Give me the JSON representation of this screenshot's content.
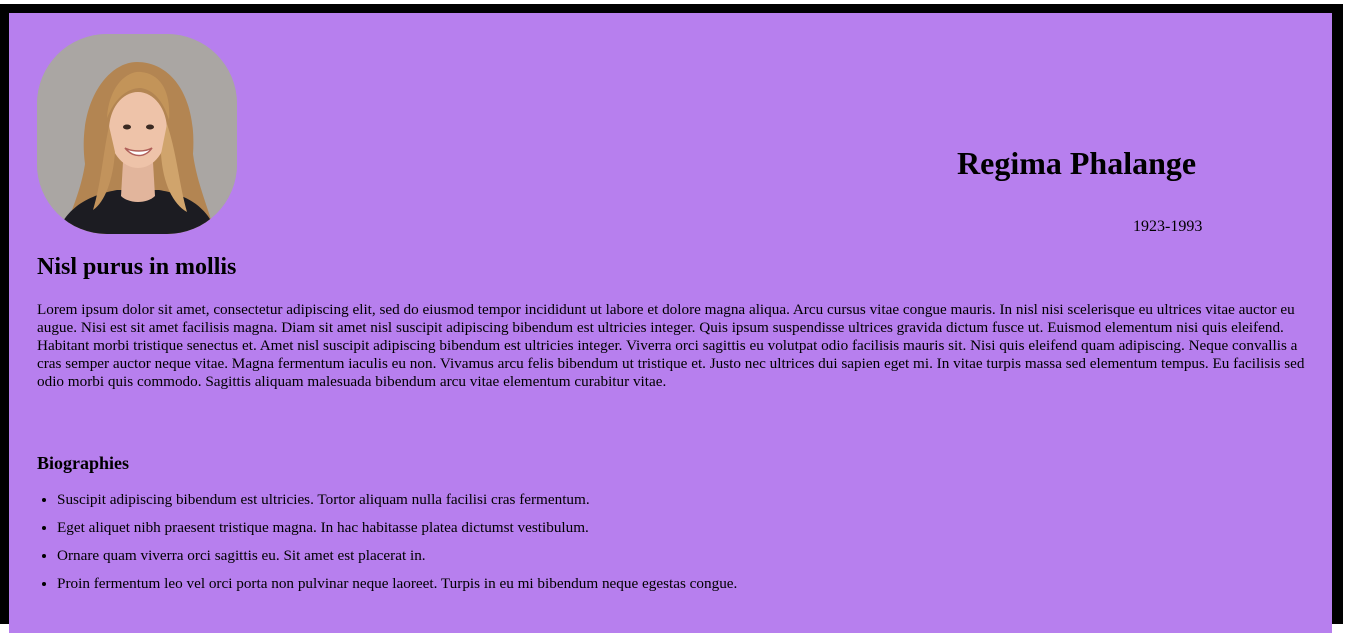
{
  "profile": {
    "name": "Regima Phalange",
    "years": "1923-1993",
    "photo_alt": "portrait photo"
  },
  "intro": {
    "heading": "Nisl purus in mollis",
    "body": "Lorem ipsum dolor sit amet, consectetur adipiscing elit, sed do eiusmod tempor incididunt ut labore et dolore magna aliqua. Arcu cursus vitae congue mauris. In nisl nisi scelerisque eu ultrices vitae auctor eu augue. Nisi est sit amet facilisis magna. Diam sit amet nisl suscipit adipiscing bibendum est ultricies integer. Quis ipsum suspendisse ultrices gravida dictum fusce ut. Euismod elementum nisi quis eleifend. Habitant morbi tristique senectus et. Amet nisl suscipit adipiscing bibendum est ultricies integer. Viverra orci sagittis eu volutpat odio facilisis mauris sit. Nisi quis eleifend quam adipiscing. Neque convallis a cras semper auctor neque vitae. Magna fermentum iaculis eu non. Vivamus arcu felis bibendum ut tristique et. Justo nec ultrices dui sapien eget mi. In vitae turpis massa sed elementum tempus. Eu facilisis sed odio morbi quis commodo. Sagittis aliquam malesuada bibendum arcu vitae elementum curabitur vitae."
  },
  "biographies": {
    "heading": "Biographies",
    "items": [
      "Suscipit adipiscing bibendum est ultricies. Tortor aliquam nulla facilisi cras fermentum.",
      "Eget aliquet nibh praesent tristique magna. In hac habitasse platea dictumst vestibulum.",
      "Ornare quam viverra orci sagittis eu. Sit amet est placerat in.",
      "Proin fermentum leo vel orci porta non pulvinar neque laoreet. Turpis in eu mi bibendum neque egestas congue."
    ]
  },
  "colors": {
    "frame": "#000000",
    "card_background": "#b77fee",
    "text": "#000000"
  }
}
